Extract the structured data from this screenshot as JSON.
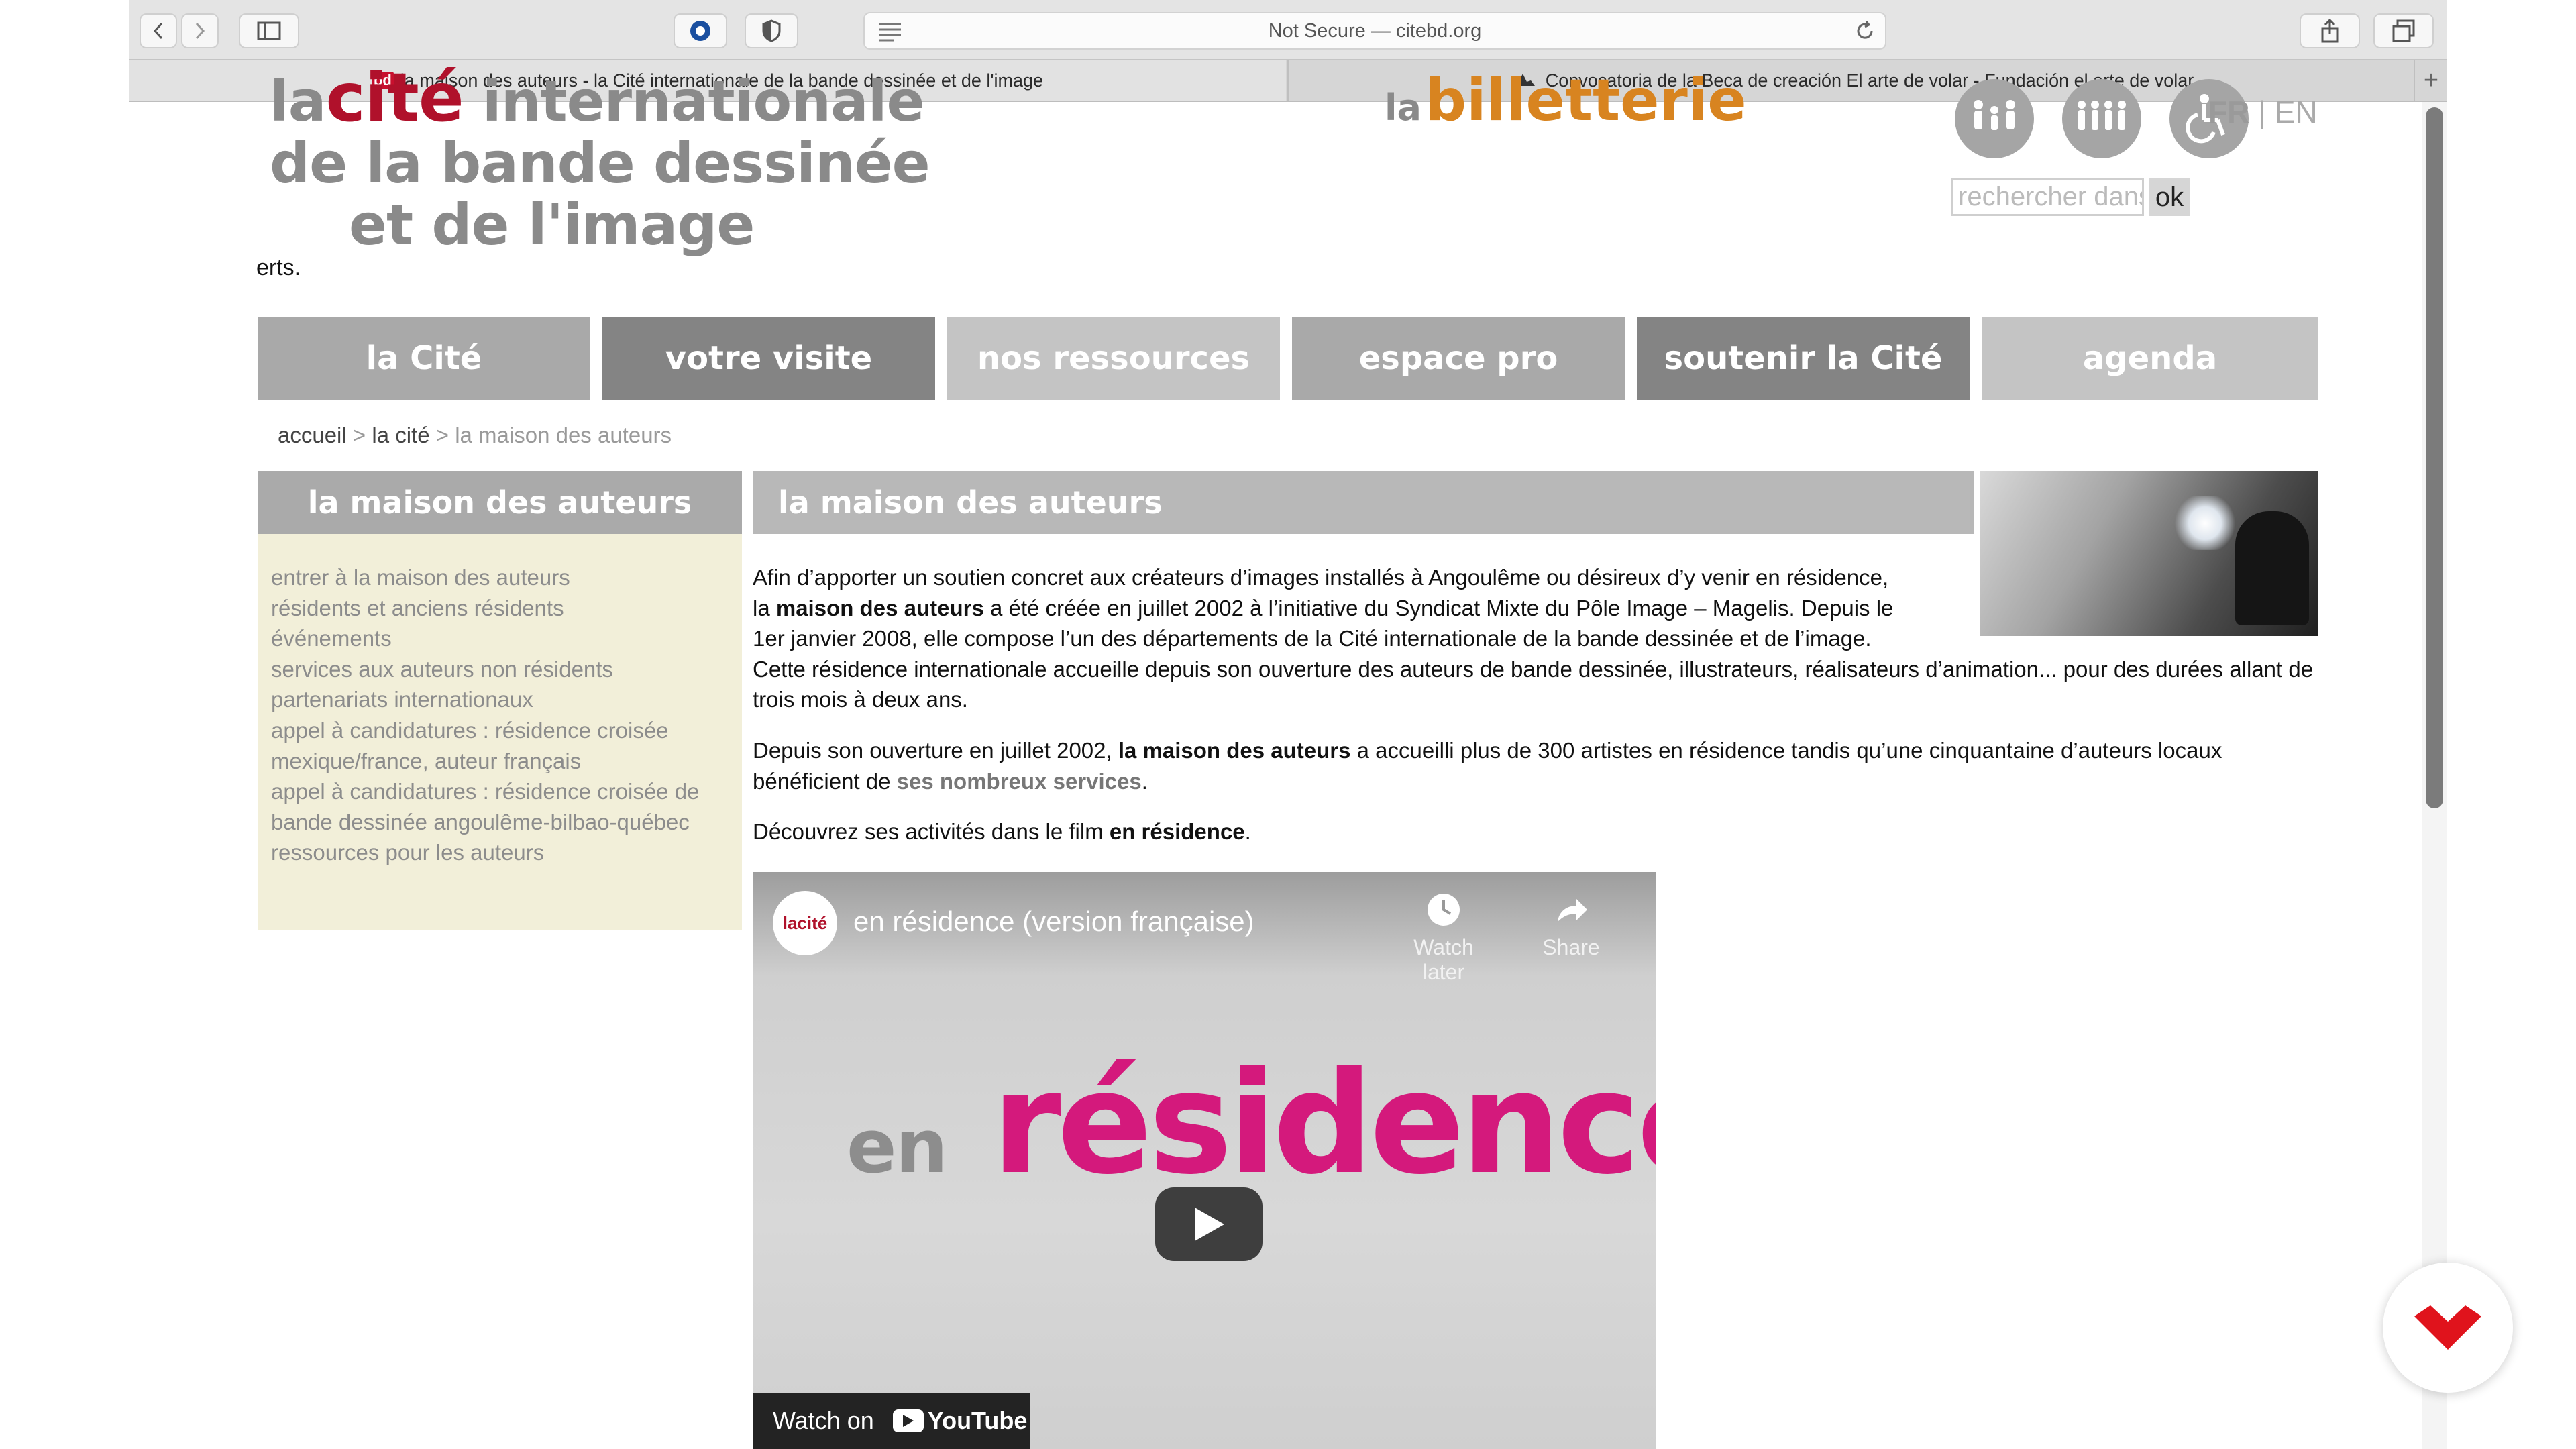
{
  "browser": {
    "address": "Not Secure — citebd.org",
    "tabs": [
      {
        "label": "la maison des auteurs - la Cité internationale de la bande dessinée et de l'image",
        "favicon": "bd"
      },
      {
        "label": "Convocatoria de la Beca de creación El arte de volar - Fundación el arte de volar"
      }
    ],
    "new_tab": "+"
  },
  "header": {
    "logo_lines": [
      "la",
      "cité",
      "internationale",
      "de la bande dessinée",
      "et de l'image"
    ],
    "truncated_text": "erts.",
    "billetterie": {
      "prefix": "la",
      "word": "billetterie"
    },
    "lang": {
      "fr": "FR",
      "sep": "|",
      "en": "EN"
    },
    "search": {
      "placeholder": "rechercher dans le site",
      "button": "ok"
    }
  },
  "nav": [
    "la Cité",
    "votre visite",
    "nos ressources",
    "espace pro",
    "soutenir la Cité",
    "agenda"
  ],
  "breadcrumb": {
    "home": "accueil",
    "sep": ">",
    "section": "la cité",
    "current": "la maison des auteurs"
  },
  "sidebar": {
    "title": "la maison des auteurs",
    "items": [
      "entrer à la maison des auteurs",
      "résidents et anciens résidents",
      "événements",
      "services aux auteurs non résidents",
      "partenariats internationaux",
      "appel à candidatures : résidence croisée",
      "mexique/france, auteur français",
      "appel à candidatures : résidence croisée de",
      "bande dessinée angoulême-bilbao-québec",
      "ressources pour les auteurs"
    ]
  },
  "main": {
    "title": "la maison des auteurs",
    "p1": {
      "a": "Afin d’apporter un soutien concret aux créateurs d’images installés à Angoulême ou désireux d’y venir en résidence,",
      "b": "la ",
      "bold": "maison des auteurs",
      "c": " a été créée en juillet 2002 à l’initiative du Syndicat Mixte du Pôle Image – Magelis. Depuis le",
      "d": "1er janvier 2008, elle compose l’un des départements de la Cité internationale de la bande dessinée et de l’image.",
      "e": "Cette résidence internationale accueille depuis son ouverture des auteurs de bande dessinée, illustrateurs, réalisateurs d’animation... pour des durées allant de trois mois à deux ans."
    },
    "p2": {
      "a": "Depuis son ouverture en juillet 2002, ",
      "bold": "la maison des auteurs",
      "b": " a accueilli plus de 300 artistes en résidence tandis qu’une cinquantaine d’auteurs locaux bénéficient de ",
      "link": "ses nombreux services",
      "c": "."
    },
    "p3": {
      "a": "Découvrez ses activités dans le film ",
      "bold": "en résidence",
      "b": "."
    }
  },
  "video": {
    "channel_logo": "lacité",
    "title": "en résidence (version française)",
    "watch_later": "Watch later",
    "share": "Share",
    "big_word_prefix": "en",
    "big_word": "résidence",
    "watch_on": "Watch on",
    "youtube": "YouTube"
  },
  "colors": {
    "accent_red": "#b0112b",
    "billet_orange": "#d88420",
    "nav_grey": "#a9a9a9",
    "nav_dark": "#848484",
    "sidebar_bg": "#f2efd9",
    "video_pink": "#d4197c"
  }
}
